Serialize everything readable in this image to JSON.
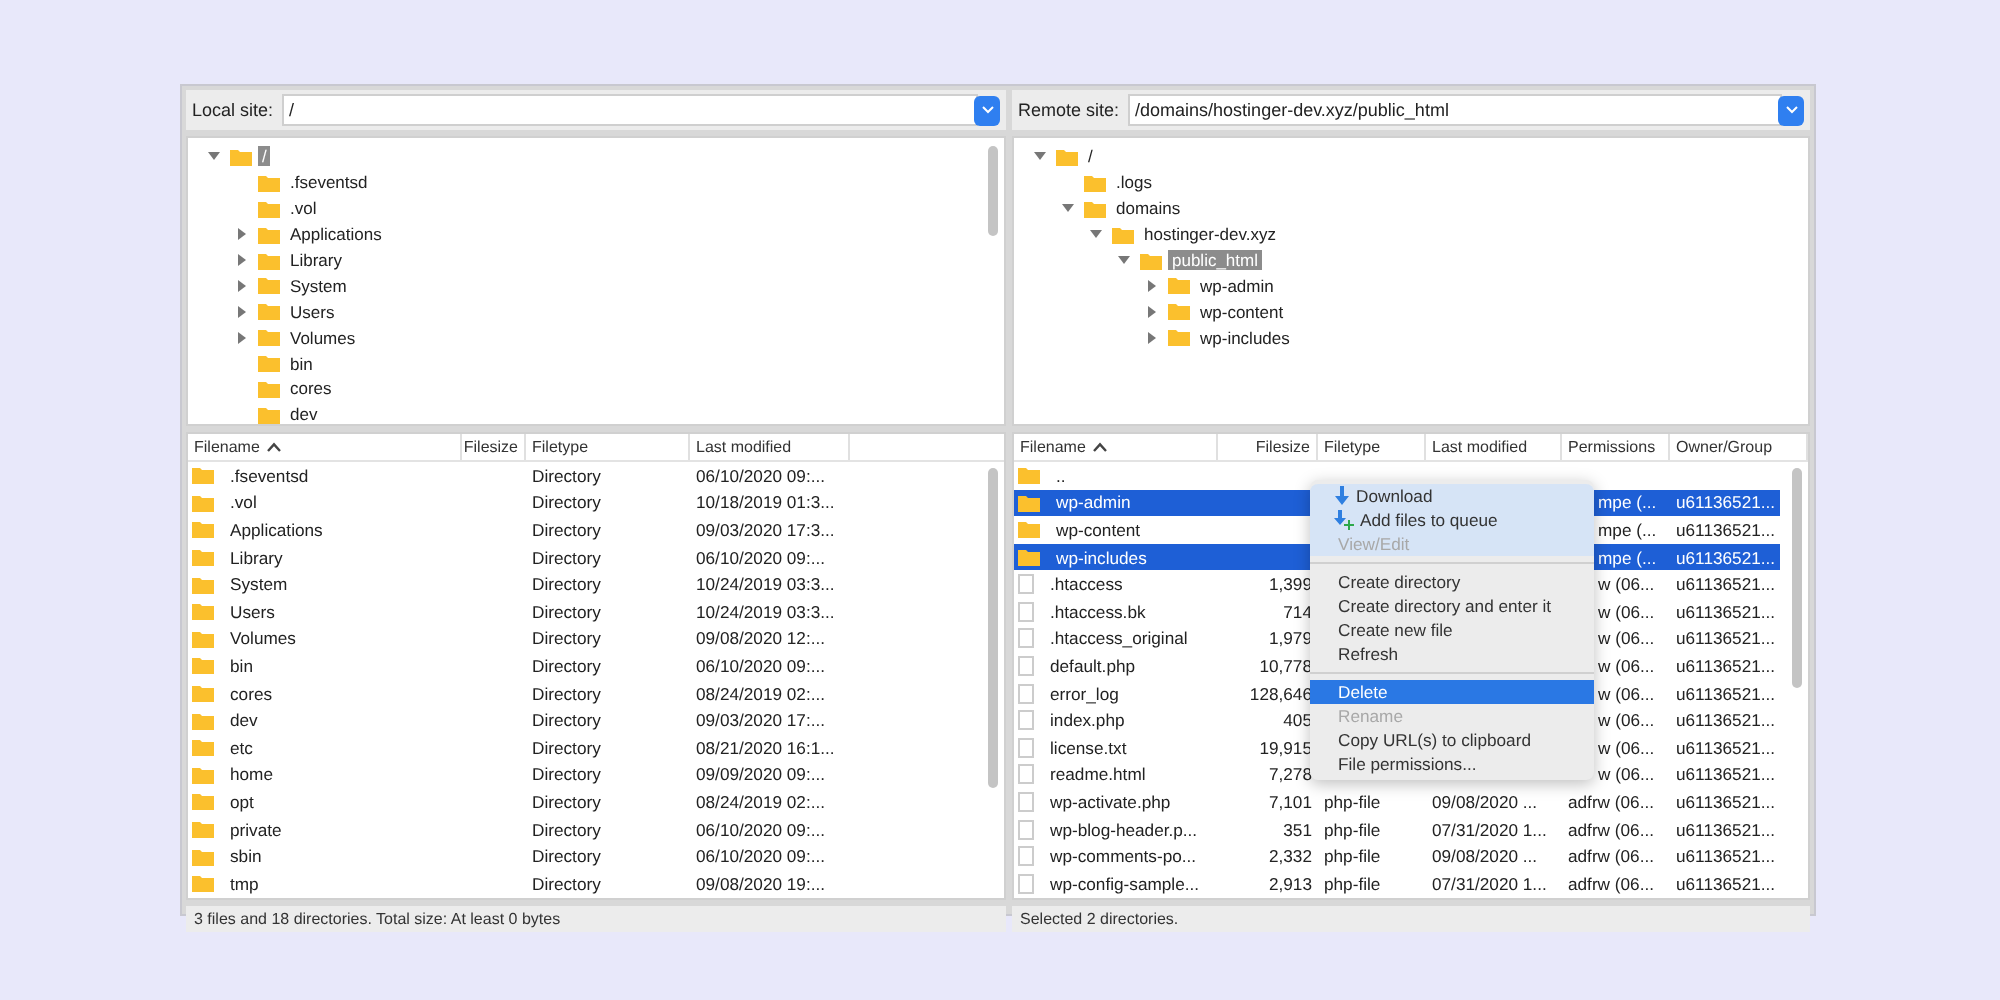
{
  "local": {
    "label": "Local site:",
    "path": "/",
    "tree": [
      {
        "label": "/",
        "kind": "expandable",
        "expanded": true,
        "selected": true,
        "children": [
          {
            "label": ".fseventsd",
            "kind": "leaf",
            "selected": false
          },
          {
            "label": ".vol",
            "kind": "leaf",
            "selected": false
          },
          {
            "label": "Applications",
            "kind": "expandable",
            "expanded": false,
            "selected": false
          },
          {
            "label": "Library",
            "kind": "expandable",
            "expanded": false,
            "selected": false
          },
          {
            "label": "System",
            "kind": "expandable",
            "expanded": false,
            "selected": false
          },
          {
            "label": "Users",
            "kind": "expandable",
            "expanded": false,
            "selected": false
          },
          {
            "label": "Volumes",
            "kind": "expandable",
            "expanded": false,
            "selected": false
          },
          {
            "label": "bin",
            "kind": "leaf",
            "selected": false
          },
          {
            "label": "cores",
            "kind": "leaf",
            "selected": false
          },
          {
            "label": "dev",
            "kind": "leaf",
            "selected": false
          }
        ]
      }
    ],
    "columns": [
      {
        "label": "Filename",
        "sorted": true
      },
      {
        "label": "Filesize"
      },
      {
        "label": "Filetype"
      },
      {
        "label": "Last modified"
      }
    ],
    "rows": [
      {
        "kind": "folder",
        "name": ".fseventsd",
        "filetype": "Directory",
        "modified": "06/10/2020 09:..."
      },
      {
        "kind": "folder",
        "name": ".vol",
        "filetype": "Directory",
        "modified": "10/18/2019 01:3..."
      },
      {
        "kind": "folder",
        "name": "Applications",
        "filetype": "Directory",
        "modified": "09/03/2020 17:3..."
      },
      {
        "kind": "folder",
        "name": "Library",
        "filetype": "Directory",
        "modified": "06/10/2020 09:..."
      },
      {
        "kind": "folder",
        "name": "System",
        "filetype": "Directory",
        "modified": "10/24/2019 03:3..."
      },
      {
        "kind": "folder",
        "name": "Users",
        "filetype": "Directory",
        "modified": "10/24/2019 03:3..."
      },
      {
        "kind": "folder",
        "name": "Volumes",
        "filetype": "Directory",
        "modified": "09/08/2020 12:..."
      },
      {
        "kind": "folder",
        "name": "bin",
        "filetype": "Directory",
        "modified": "06/10/2020 09:..."
      },
      {
        "kind": "folder",
        "name": "cores",
        "filetype": "Directory",
        "modified": "08/24/2019 02:..."
      },
      {
        "kind": "folder",
        "name": "dev",
        "filetype": "Directory",
        "modified": "09/03/2020 17:..."
      },
      {
        "kind": "folder",
        "name": "etc",
        "filetype": "Directory",
        "modified": "08/21/2020 16:1..."
      },
      {
        "kind": "folder",
        "name": "home",
        "filetype": "Directory",
        "modified": "09/09/2020 09:..."
      },
      {
        "kind": "folder",
        "name": "opt",
        "filetype": "Directory",
        "modified": "08/24/2019 02:..."
      },
      {
        "kind": "folder",
        "name": "private",
        "filetype": "Directory",
        "modified": "06/10/2020 09:..."
      },
      {
        "kind": "folder",
        "name": "sbin",
        "filetype": "Directory",
        "modified": "06/10/2020 09:..."
      },
      {
        "kind": "folder",
        "name": "tmp",
        "filetype": "Directory",
        "modified": "09/08/2020 19:..."
      }
    ],
    "status": "3 files and 18 directories. Total size: At least 0 bytes"
  },
  "remote": {
    "label": "Remote site:",
    "path": "/domains/hostinger-dev.xyz/public_html",
    "tree": [
      {
        "label": "/",
        "kind": "expandable",
        "expanded": true,
        "selected": false,
        "children": [
          {
            "label": ".logs",
            "kind": "leaf",
            "selected": false
          },
          {
            "label": "domains",
            "kind": "expandable",
            "expanded": true,
            "selected": false,
            "children": [
              {
                "label": "hostinger-dev.xyz",
                "kind": "expandable",
                "expanded": true,
                "selected": false,
                "children": [
                  {
                    "label": "public_html",
                    "kind": "expandable",
                    "expanded": true,
                    "selected": true,
                    "children": [
                      {
                        "label": "wp-admin",
                        "kind": "expandable",
                        "expanded": false,
                        "selected": false
                      },
                      {
                        "label": "wp-content",
                        "kind": "expandable",
                        "expanded": false,
                        "selected": false
                      },
                      {
                        "label": "wp-includes",
                        "kind": "expandable",
                        "expanded": false,
                        "selected": false
                      }
                    ]
                  }
                ]
              }
            ]
          }
        ]
      }
    ],
    "columns": [
      {
        "label": "Filename",
        "sorted": true
      },
      {
        "label": "Filesize"
      },
      {
        "label": "Filetype"
      },
      {
        "label": "Last modified"
      },
      {
        "label": "Permissions"
      },
      {
        "label": "Owner/Group"
      }
    ],
    "rows": [
      {
        "kind": "folder",
        "name": "..",
        "selected": false
      },
      {
        "kind": "folder",
        "name": "wp-admin",
        "permissions": "mpe (...",
        "owner": "u61136521...",
        "selected": true,
        "covered": true
      },
      {
        "kind": "folder",
        "name": "wp-content",
        "permissions": "mpe (...",
        "owner": "u61136521...",
        "selected": false,
        "covered": true
      },
      {
        "kind": "folder",
        "name": "wp-includes",
        "permissions": "mpe (...",
        "owner": "u61136521...",
        "selected": true,
        "covered": true
      },
      {
        "kind": "file",
        "name": ".htaccess",
        "filesize": "1,399",
        "permissions": "w (06...",
        "owner": "u61136521...",
        "selected": false,
        "covered": true
      },
      {
        "kind": "file",
        "name": ".htaccess.bk",
        "filesize": "714",
        "permissions": "w (06...",
        "owner": "u61136521...",
        "selected": false,
        "covered": true
      },
      {
        "kind": "file",
        "name": ".htaccess_original",
        "filesize": "1,979",
        "permissions": "w (06...",
        "owner": "u61136521...",
        "selected": false,
        "covered": true
      },
      {
        "kind": "file",
        "name": "default.php",
        "filesize": "10,778",
        "permissions": "w (06...",
        "owner": "u61136521...",
        "selected": false,
        "covered": true
      },
      {
        "kind": "file",
        "name": "error_log",
        "filesize": "128,646",
        "permissions": "w (06...",
        "owner": "u61136521...",
        "selected": false,
        "covered": true
      },
      {
        "kind": "file",
        "name": "index.php",
        "filesize": "405",
        "permissions": "w (06...",
        "owner": "u61136521...",
        "selected": false,
        "covered": true
      },
      {
        "kind": "file",
        "name": "license.txt",
        "filesize": "19,915",
        "permissions": "w (06...",
        "owner": "u61136521...",
        "selected": false,
        "covered": true
      },
      {
        "kind": "file",
        "name": "readme.html",
        "filesize": "7,278",
        "permissions": "w (06...",
        "owner": "u61136521...",
        "selected": false,
        "covered": true
      },
      {
        "kind": "file",
        "name": "wp-activate.php",
        "filesize": "7,101",
        "filetype": "php-file",
        "modified": "09/08/2020 ...",
        "permissions": "adfrw (06...",
        "owner": "u61136521...",
        "selected": false,
        "covered": false
      },
      {
        "kind": "file",
        "name": "wp-blog-header.p...",
        "filesize": "351",
        "filetype": "php-file",
        "modified": "07/31/2020 1...",
        "permissions": "adfrw (06...",
        "owner": "u61136521...",
        "selected": false,
        "covered": false
      },
      {
        "kind": "file",
        "name": "wp-comments-po...",
        "filesize": "2,332",
        "filetype": "php-file",
        "modified": "09/08/2020 ...",
        "permissions": "adfrw (06...",
        "owner": "u61136521...",
        "selected": false,
        "covered": false
      },
      {
        "kind": "file",
        "name": "wp-config-sample...",
        "filesize": "2,913",
        "filetype": "php-file",
        "modified": "07/31/2020 1...",
        "permissions": "adfrw (06...",
        "owner": "u61136521...",
        "selected": false,
        "covered": false
      }
    ],
    "status": "Selected 2 directories."
  },
  "context_menu": [
    {
      "kind": "download",
      "label": "Download",
      "disabled": false,
      "selected": false
    },
    {
      "kind": "queue",
      "label": "Add files to queue",
      "disabled": false,
      "selected": false
    },
    {
      "kind": "plain",
      "label": "View/Edit",
      "disabled": true,
      "selected": false
    },
    {
      "kind": "separator"
    },
    {
      "kind": "plain",
      "label": "Create directory",
      "disabled": false,
      "selected": false
    },
    {
      "kind": "plain",
      "label": "Create directory and enter it",
      "disabled": false,
      "selected": false
    },
    {
      "kind": "plain",
      "label": "Create new file",
      "disabled": false,
      "selected": false
    },
    {
      "kind": "plain",
      "label": "Refresh",
      "disabled": false,
      "selected": false
    },
    {
      "kind": "separator"
    },
    {
      "kind": "plain",
      "label": "Delete",
      "disabled": false,
      "selected": true
    },
    {
      "kind": "plain",
      "label": "Rename",
      "disabled": true,
      "selected": false
    },
    {
      "kind": "plain",
      "label": "Copy URL(s) to clipboard",
      "disabled": false,
      "selected": false
    },
    {
      "kind": "plain",
      "label": "File permissions...",
      "disabled": false,
      "selected": false
    }
  ]
}
